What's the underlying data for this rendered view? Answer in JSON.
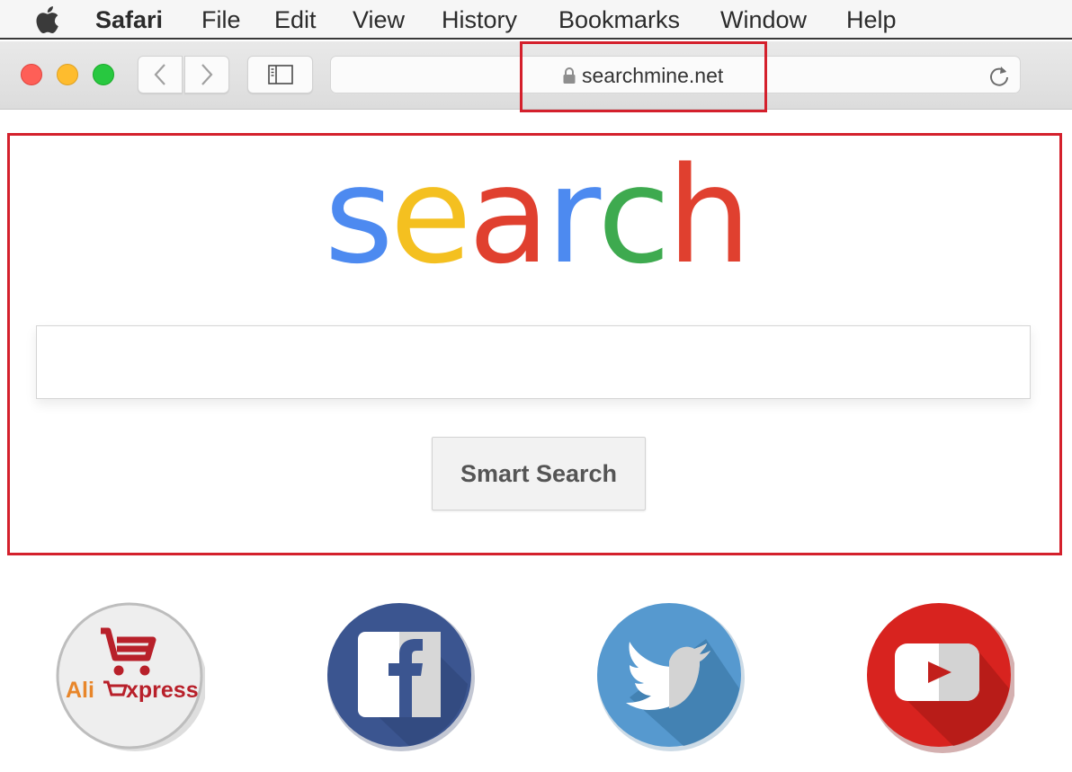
{
  "menubar": {
    "apple_icon": "apple-logo-icon",
    "app_name": "Safari",
    "items": [
      "File",
      "Edit",
      "View",
      "History",
      "Bookmarks",
      "Window",
      "Help"
    ]
  },
  "toolbar": {
    "traffic_lights": {
      "close": "#fe5f57",
      "minimize": "#febc2e",
      "zoom": "#28c840"
    },
    "back_icon": "chevron-left-icon",
    "forward_icon": "chevron-right-icon",
    "sidebar_icon": "sidebar-icon",
    "address": {
      "lock_icon": "lock-icon",
      "url": "searchmine.net",
      "reload_icon": "reload-icon"
    }
  },
  "page": {
    "logo": {
      "letters": [
        {
          "char": "s",
          "color": "#4d8af0"
        },
        {
          "char": "e",
          "color": "#f4c020"
        },
        {
          "char": "a",
          "color": "#e0402f"
        },
        {
          "char": "r",
          "color": "#4d8af0"
        },
        {
          "char": "c",
          "color": "#3eaa4f"
        },
        {
          "char": "h",
          "color": "#e0402f"
        }
      ]
    },
    "search_input": {
      "value": "",
      "placeholder": ""
    },
    "smart_search_label": "Smart Search",
    "shortcuts": [
      {
        "name": "AliExpress",
        "label_ali": "Ali",
        "label_express": "xpress",
        "icon": "aliexpress-icon"
      },
      {
        "name": "Facebook",
        "icon": "facebook-icon"
      },
      {
        "name": "Twitter",
        "icon": "twitter-icon"
      },
      {
        "name": "YouTube",
        "icon": "youtube-icon"
      }
    ]
  },
  "annotations": {
    "highlight_color": "#d4202c"
  }
}
